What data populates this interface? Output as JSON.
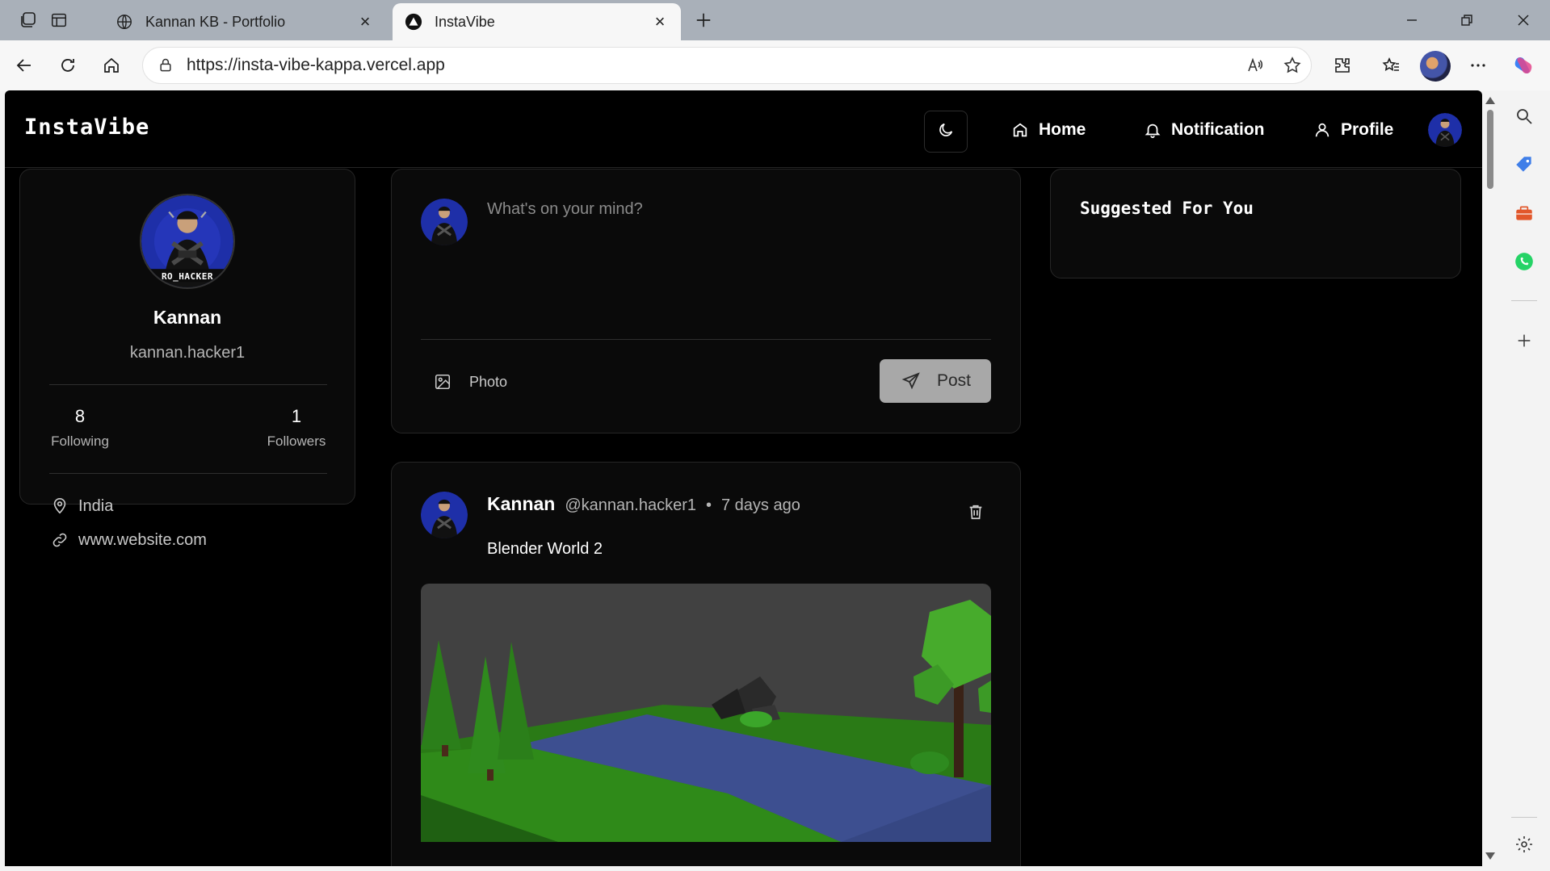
{
  "browser": {
    "tabs": [
      {
        "title": "Kannan KB - Portfolio",
        "active": false
      },
      {
        "title": "InstaVibe",
        "active": true
      }
    ],
    "url": "https://insta-vibe-kappa.vercel.app"
  },
  "header": {
    "brand": "InstaVibe",
    "nav": {
      "home": "Home",
      "notification": "Notification",
      "profile": "Profile"
    }
  },
  "profile_card": {
    "name": "Kannan",
    "handle": "kannan.hacker1",
    "following_count": "8",
    "following_label": "Following",
    "followers_count": "1",
    "followers_label": "Followers",
    "location": "India",
    "website": "www.website.com",
    "avatar_text": "RO_HACKER"
  },
  "composer": {
    "placeholder": "What's on your mind?",
    "photo_label": "Photo",
    "post_label": "Post"
  },
  "post": {
    "author": "Kannan",
    "handle": "@kannan.hacker1",
    "separator": "•",
    "time": "7 days ago",
    "text": "Blender World 2"
  },
  "suggestions": {
    "title": "Suggested For You"
  },
  "colors": {
    "page_bg": "#000000",
    "card_bg": "#0a0a0a",
    "card_border": "#262626",
    "post_button_bg": "#a8a8a8",
    "avatar_blue": "#1e2fa8"
  }
}
